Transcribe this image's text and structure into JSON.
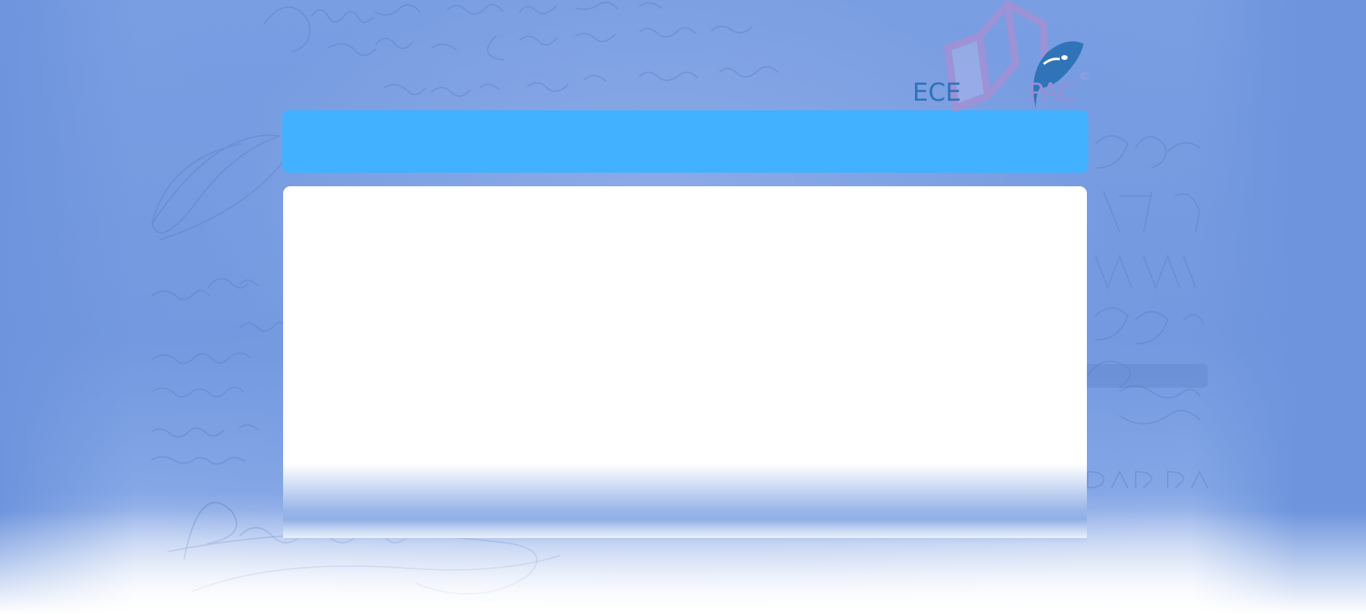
{
  "logo": {
    "text_left": "ECE",
    "text_right": "PAC",
    "copyright_symbol": "©",
    "icon": "book-quill-icon",
    "colors": {
      "blue": "#2e73b8",
      "lavender": "#9a8fd3"
    }
  },
  "header_bar": {
    "color": "#42b1ff"
  },
  "content_panel": {
    "color": "#ffffff"
  },
  "background": {
    "color": "#7098df",
    "decoration": "calligraphy-script-background"
  }
}
